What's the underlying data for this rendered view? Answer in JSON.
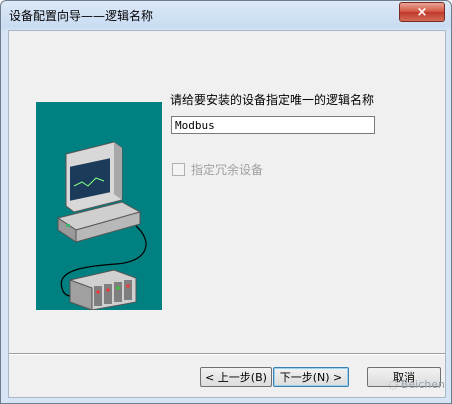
{
  "window": {
    "title": "设备配置向导——逻辑名称",
    "close_icon": "×"
  },
  "content": {
    "prompt": "请给要安装的设备指定唯一的逻辑名称",
    "name_value": "Modbus",
    "redundant_label": "指定冗余设备",
    "redundant_checked": false
  },
  "buttons": {
    "prev": "< 上一步(B)",
    "next": "下一步(N) >",
    "cancel": "取消"
  },
  "watermark": "Beichen",
  "colors": {
    "illustration_bg": "#008080"
  }
}
